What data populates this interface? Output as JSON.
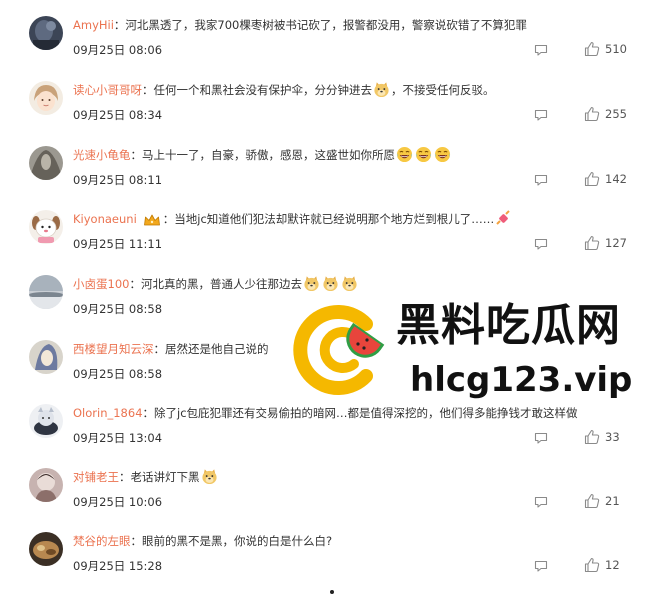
{
  "comments": [
    {
      "author": "AmyHii",
      "text": "河北黑透了，我家700棵枣树被书记砍了，报警都没用，警察说砍错了不算犯罪",
      "time": "09月25日 08:06",
      "likes": "510"
    },
    {
      "author": "读心小哥哥呀",
      "text": "任何一个和黑社会没有保护伞，分分钟进去",
      "text_after": "，不接受任何反驳。",
      "time": "09月25日 08:34",
      "likes": "255"
    },
    {
      "author": "光速小龟龟",
      "text": "马上十一了，自豪，骄傲，感恩，这盛世如你所愿",
      "time": "09月25日 08:11",
      "likes": "142"
    },
    {
      "author": "Kiyonaeuni",
      "text": "当地jc知道他们犯法却默许就已经说明那个地方烂到根儿了……",
      "time": "09月25日 11:11",
      "likes": "127"
    },
    {
      "author": "小卤蛋100",
      "text": "河北真的黑，普通人少往那边去",
      "time": "09月25日 08:58",
      "likes": ""
    },
    {
      "author": "西楼望月知云深",
      "text": "居然还是他自己说的",
      "time": "09月25日 08:58",
      "likes": ""
    },
    {
      "author": "Olorin_1864",
      "text": "除了jc包庇犯罪还有交易偷拍的暗网…都是值得深挖的，他们得多能挣钱才敢这样做",
      "time": "09月25日 13:04",
      "likes": "33"
    },
    {
      "author": "对铺老王",
      "text": "老话讲灯下黑",
      "time": "09月25日 10:06",
      "likes": "21"
    },
    {
      "author": "梵谷的左眼",
      "text": "眼前的黑不是黑，你说的白是什么白?",
      "time": "09月25日 15:28",
      "likes": "12"
    }
  ],
  "watermark": {
    "title": "黑料吃瓜网",
    "url": "hlcg123.vip"
  },
  "colors": {
    "author": "#eb7350",
    "text": "#333333",
    "icon": "#8a8a8a",
    "logo_yellow": "#f5b800",
    "logo_red": "#e8453c",
    "logo_green": "#2f9e44"
  }
}
